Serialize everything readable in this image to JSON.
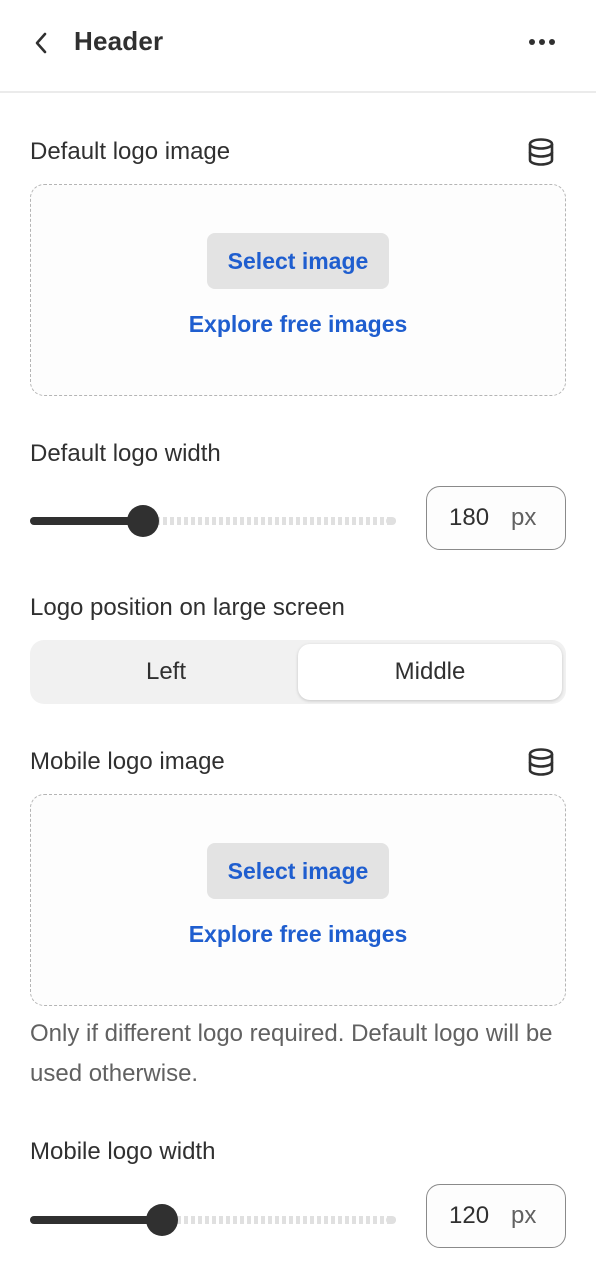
{
  "header": {
    "title": "Header",
    "back_icon": "chevron-left-icon",
    "more_icon": "more-horizontal-icon"
  },
  "default_logo": {
    "label": "Default logo image",
    "source_icon": "database-icon",
    "select_label": "Select image",
    "explore_label": "Explore free images"
  },
  "default_width": {
    "label": "Default logo width",
    "value": "180",
    "unit": "px",
    "slider_fraction": 0.31
  },
  "logo_position": {
    "label": "Logo position on large screen",
    "options": [
      "Left",
      "Middle"
    ],
    "selected": "Middle"
  },
  "mobile_logo": {
    "label": "Mobile logo image",
    "source_icon": "database-icon",
    "select_label": "Select image",
    "explore_label": "Explore free images",
    "help_text": "Only if different logo required. Default logo will be used otherwise."
  },
  "mobile_width": {
    "label": "Mobile logo width",
    "value": "120",
    "unit": "px",
    "slider_fraction": 0.36
  },
  "colors": {
    "text": "#303030",
    "link": "#1f5ecf",
    "button_bg": "#e3e3e3",
    "muted": "#616161"
  }
}
